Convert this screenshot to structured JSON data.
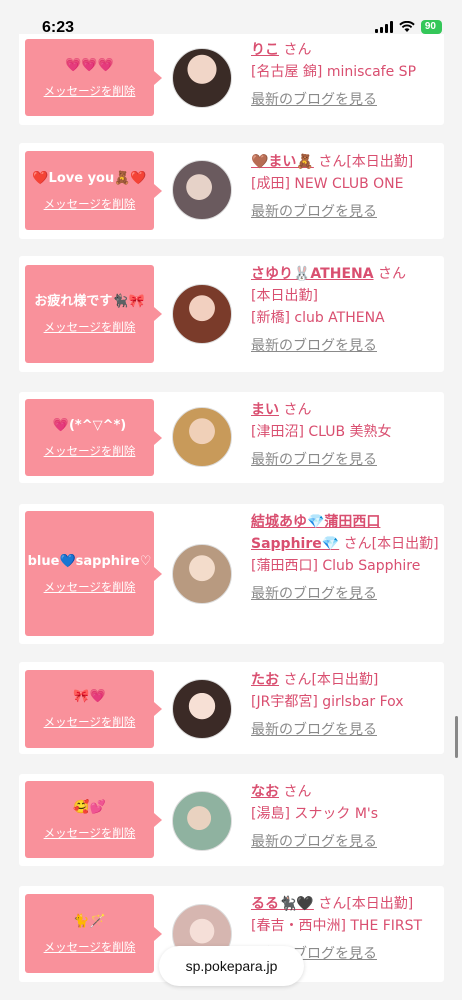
{
  "status_bar": {
    "time": "6:23",
    "battery": "90"
  },
  "colors": {
    "accent_pink": "#f9919b",
    "name_color": "#d94f70",
    "link_gray": "#8a8a8a"
  },
  "url_bar": {
    "domain": "sp.pokepara.jp"
  },
  "delete_label": "メッセージを削除",
  "blog_label": "最新のブログを見る",
  "entries": [
    {
      "message": "💗💗💗",
      "name": "りこ",
      "honorific": "さん",
      "status": "",
      "shop": "[名古屋 錦] miniscafe SP"
    },
    {
      "message": "❤️Love you🧸❤️",
      "name": "🤎まい🧸",
      "honorific": "さん",
      "status": "[本日出勤]",
      "shop": "[成田] NEW CLUB ONE"
    },
    {
      "message": "お疲れ様です🐈‍⬛🎀",
      "name": "さゆり🐰ATHENA",
      "honorific": "さん",
      "status": "[本日出勤]",
      "shop": "[新橋] club ATHENA"
    },
    {
      "message": "💗(*^▽^*)",
      "name": "まい",
      "honorific": "さん",
      "status": "",
      "shop": "[津田沼] CLUB 美熟女"
    },
    {
      "message": "blue💙sapphire♡",
      "name": "結城あゆ💎蒲田西口Sapphire💎",
      "honorific": "さん",
      "status": "[本日出勤]",
      "shop": "[蒲田西口] Club Sapphire"
    },
    {
      "message": "🎀💗",
      "name": "たお",
      "honorific": "さん",
      "status": "[本日出勤]",
      "shop": "[JR宇都宮] girlsbar Fox"
    },
    {
      "message": "🥰💕",
      "name": "なお",
      "honorific": "さん",
      "status": "",
      "shop": "[湯島] スナック M's"
    },
    {
      "message": "🐈🪄",
      "name": "るる🐈‍⬛🖤",
      "honorific": "さん",
      "status": "[本日出勤]",
      "shop": "[春吉・西中洲] THE FIRST"
    }
  ]
}
